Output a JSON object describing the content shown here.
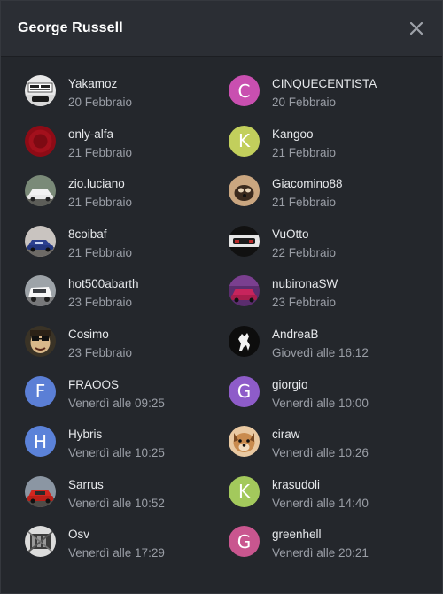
{
  "dialog": {
    "title": "George Russell",
    "close_icon": "close-icon"
  },
  "users": [
    {
      "name": "Yakamoz",
      "date": "20 Febbraio",
      "avatar": {
        "type": "image",
        "icon": "car-star-logo-avatar"
      }
    },
    {
      "name": "CINQUECENTISTA",
      "date": "20 Febbraio",
      "avatar": {
        "type": "letter",
        "letter": "C",
        "color": "#c94fb0"
      }
    },
    {
      "name": "only-alfa",
      "date": "21 Febbraio",
      "avatar": {
        "type": "image",
        "icon": "red-circle-avatar"
      }
    },
    {
      "name": "Kangoo",
      "date": "21 Febbraio",
      "avatar": {
        "type": "letter",
        "letter": "K",
        "color": "#c2cf5c"
      }
    },
    {
      "name": "zio.luciano",
      "date": "21 Febbraio",
      "avatar": {
        "type": "image",
        "icon": "white-car-avatar"
      }
    },
    {
      "name": "Giacomino88",
      "date": "21 Febbraio",
      "avatar": {
        "type": "image",
        "icon": "dog-photo-avatar"
      }
    },
    {
      "name": "8coibaf",
      "date": "21 Febbraio",
      "avatar": {
        "type": "image",
        "icon": "blue-car-avatar"
      }
    },
    {
      "name": "VuOtto",
      "date": "22 Febbraio",
      "avatar": {
        "type": "image",
        "icon": "dark-car-avatar"
      }
    },
    {
      "name": "hot500abarth",
      "date": "23 Febbraio",
      "avatar": {
        "type": "image",
        "icon": "white-fiat-avatar"
      }
    },
    {
      "name": "nubironaSW",
      "date": "23 Febbraio",
      "avatar": {
        "type": "image",
        "icon": "purple-car-avatar"
      }
    },
    {
      "name": "Cosimo",
      "date": "23 Febbraio",
      "avatar": {
        "type": "image",
        "icon": "cartoon-face-avatar"
      }
    },
    {
      "name": "AndreaB",
      "date": "Giovedì alle 16:12",
      "avatar": {
        "type": "image",
        "icon": "prancing-horse-avatar"
      }
    },
    {
      "name": "FRAOOS",
      "date": "Venerdì alle 09:25",
      "avatar": {
        "type": "letter",
        "letter": "F",
        "color": "#5b7fd6"
      }
    },
    {
      "name": "giorgio",
      "date": "Venerdì alle 10:00",
      "avatar": {
        "type": "letter",
        "letter": "G",
        "color": "#8e5cc9"
      }
    },
    {
      "name": "Hybris",
      "date": "Venerdì alle 10:25",
      "avatar": {
        "type": "letter",
        "letter": "H",
        "color": "#5b82d9"
      }
    },
    {
      "name": "ciraw",
      "date": "Venerdì alle 10:26",
      "avatar": {
        "type": "image",
        "icon": "dog-face-avatar"
      }
    },
    {
      "name": "Sarrus",
      "date": "Venerdì alle 10:52",
      "avatar": {
        "type": "image",
        "icon": "red-car-avatar"
      }
    },
    {
      "name": "krasudoli",
      "date": "Venerdì alle 14:40",
      "avatar": {
        "type": "letter",
        "letter": "K",
        "color": "#a3c95c"
      }
    },
    {
      "name": "Osv",
      "date": "Venerdì alle 17:29",
      "avatar": {
        "type": "image",
        "icon": "engine-avatar"
      }
    },
    {
      "name": "greenhell",
      "date": "Venerdì alle 20:21",
      "avatar": {
        "type": "letter",
        "letter": "G",
        "color": "#c9568f"
      }
    }
  ]
}
